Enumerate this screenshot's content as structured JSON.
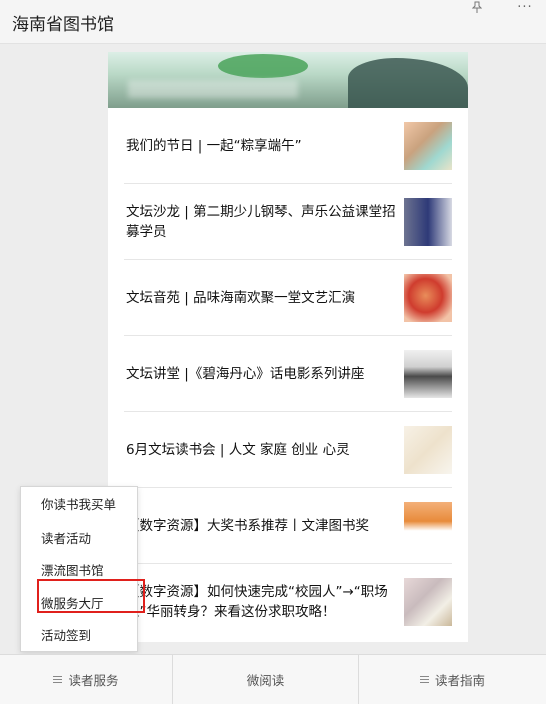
{
  "window": {
    "title": "海南省图书馆",
    "pin_icon": "pin-icon",
    "more_icon": "more-icon"
  },
  "articles": [
    {
      "title": "我们的节日 | 一起“粽享端午”",
      "thumb_icon": "article-thumbnail"
    },
    {
      "title": "文坛沙龙 | 第二期少儿钢琴、声乐公益课堂招募学员",
      "thumb_icon": "article-thumbnail"
    },
    {
      "title": "文坛音苑 | 品味海南欢聚一堂文艺汇演",
      "thumb_icon": "article-thumbnail"
    },
    {
      "title": "文坛讲堂 |《碧海丹心》话电影系列讲座",
      "thumb_icon": "article-thumbnail"
    },
    {
      "title": "6月文坛读书会 | 人文 家庭 创业 心灵",
      "thumb_icon": "article-thumbnail"
    },
    {
      "title": "【数字资源】大奖书系推荐丨文津图书奖",
      "thumb_icon": "article-thumbnail"
    },
    {
      "title": "【数字资源】如何快速完成“校园人”→“职场人”华丽转身？来看这份求职攻略！",
      "thumb_icon": "article-thumbnail"
    }
  ],
  "popup_menu": {
    "items": [
      "你读书我买单",
      "读者活动",
      "漂流图书馆",
      "微服务大厅",
      "活动签到"
    ],
    "highlighted": "微服务大厅",
    "highlight_color": "#e0201c"
  },
  "bottom_tabs": [
    {
      "label": "读者服务",
      "has_menu_icon": true
    },
    {
      "label": "微阅读",
      "has_menu_icon": false
    },
    {
      "label": "读者指南",
      "has_menu_icon": true
    }
  ]
}
